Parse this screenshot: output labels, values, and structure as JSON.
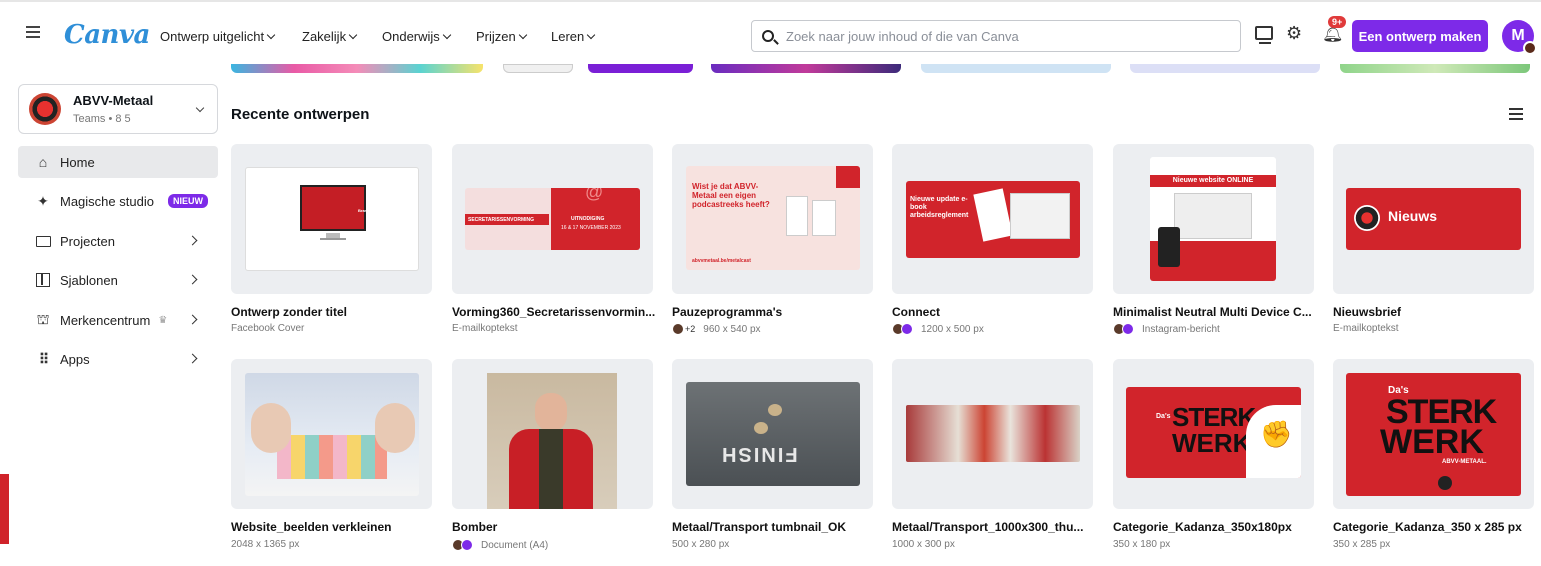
{
  "brand": {
    "logo_text": "Canva",
    "accent": "#7d2ae8"
  },
  "nav": [
    {
      "label": "Ontwerp uitgelicht"
    },
    {
      "label": "Zakelijk"
    },
    {
      "label": "Onderwijs"
    },
    {
      "label": "Prijzen"
    },
    {
      "label": "Leren"
    }
  ],
  "search": {
    "placeholder": "Zoek naar jouw inhoud of die van Canva"
  },
  "header": {
    "notifications_badge": "9+",
    "cta_label": "Een ontwerp maken",
    "avatar_letter": "M"
  },
  "team": {
    "name": "ABVV-Metaal",
    "sub": "Teams • 8 5"
  },
  "sidebar": {
    "items": [
      {
        "label": "Home",
        "icon": "home-icon"
      },
      {
        "label": "Magische studio",
        "icon": "sparkle-icon",
        "badge": "NIEUW"
      },
      {
        "label": "Projecten",
        "icon": "folder-icon"
      },
      {
        "label": "Sjablonen",
        "icon": "template-icon"
      },
      {
        "label": "Merkencentrum",
        "icon": "brand-icon"
      },
      {
        "label": "Apps",
        "icon": "apps-icon"
      }
    ]
  },
  "main": {
    "section_title": "Recente ontwerpen",
    "designs": [
      {
        "name": "Ontwerp zonder titel",
        "meta": "Facebook Cover"
      },
      {
        "name": "Vorming360_Secretarissenvormin...",
        "meta": "E-mailkoptekst"
      },
      {
        "name": "Pauzeprogramma's",
        "meta": "960 x 540 px",
        "avatars_extra": "+2"
      },
      {
        "name": "Connect",
        "meta": "1200 x 500 px"
      },
      {
        "name": "Minimalist Neutral Multi Device C...",
        "meta": "Instagram-bericht"
      },
      {
        "name": "Nieuwsbrief",
        "meta": "E-mailkoptekst"
      },
      {
        "name": "Website_beelden verkleinen",
        "meta": "2048 x 1365 px"
      },
      {
        "name": "Bomber",
        "meta": "Document (A4)"
      },
      {
        "name": "Metaal/Transport tumbnail_OK",
        "meta": "500 x 280 px"
      },
      {
        "name": "Metaal/Transport_1000x300_thu...",
        "meta": "1000 x 300 px"
      },
      {
        "name": "Categorie_Kadanza_350x180px",
        "meta": "350 x 180 px"
      },
      {
        "name": "Categorie_Kadanza_350 x 285 px",
        "meta": "350 x 285 px"
      }
    ],
    "thumb_text": {
      "t1": "Brandbook",
      "t2a": "SECRETARISSENVORMING",
      "t2b": "UITNODIGING",
      "t2c": "16 & 17 NOVEMBER 2023",
      "t3": "Wist je dat ABVV-Metaal een eigen podcastreeks heeft?",
      "t3b": "abvvmetaal.be/metalcast",
      "t4": "Nieuwe update e-book arbeidsreglement",
      "t5": "Nieuwe website ONLINE",
      "t6": "Nieuws",
      "t9": "FINISH",
      "t11a": "Da's",
      "t11b": "STERK",
      "t11c": "WERK",
      "t12c": "ABVV-METAAL."
    }
  }
}
